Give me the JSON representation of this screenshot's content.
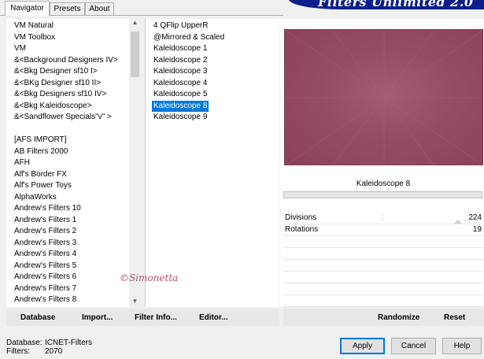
{
  "tabs": [
    {
      "label": "Navigator",
      "active": true
    },
    {
      "label": "Presets",
      "active": false
    },
    {
      "label": "About",
      "active": false
    }
  ],
  "banner": {
    "title": "Filters Unlimited 2.0",
    "color": "#0a1f8c"
  },
  "categories": [
    "VM Natural",
    "VM Toolbox",
    "VM",
    "&<Background Designers IV>",
    "&<Bkg Designer sf10 I>",
    "&<BKg Designer sf10 II>",
    "&<Bkg Designers sf10 IV>",
    "&<Bkg Kaleidoscope>",
    "&<Sandflower Specials\"v\" >",
    "",
    "[AFS IMPORT]",
    "AB Filters 2000",
    "AFH",
    "Alf's Border FX",
    "Alf's Power Toys",
    "AlphaWorks",
    "Andrew's Filters 10",
    "Andrew's Filters 1",
    "Andrew's Filters 2",
    "Andrew's Filters 3",
    "Andrew's Filters 4",
    "Andrew's Filters 5",
    "Andrew's Filters 6",
    "Andrew's Filters 7",
    "Andrew's Filters 8"
  ],
  "filters": [
    "4 QFlip UpperR",
    "@Mirrored & Scaled",
    "Kaleidoscope 1",
    "Kaleidoscope 2",
    "Kaleidoscope 3",
    "Kaleidoscope 4",
    "Kaleidoscope 5",
    "Kaleidoscope 8",
    "Kaleidoscope 9"
  ],
  "selected_filter": "Kaleidoscope 8",
  "preview": {
    "filter_name": "Kaleidoscope 8",
    "color": "#9a5268"
  },
  "params": [
    {
      "label": "Divisions",
      "value": "224"
    },
    {
      "label": "Rotations",
      "value": "19"
    }
  ],
  "toolbar": {
    "database": "Database",
    "import": "Import...",
    "filter_info": "Filter Info...",
    "editor": "Editor...",
    "randomize": "Randomize",
    "reset": "Reset"
  },
  "footer": {
    "database_label": "Database:",
    "database_value": "ICNET-Filters",
    "filters_label": "Filters:",
    "filters_value": "2070",
    "apply": "Apply",
    "cancel": "Cancel",
    "help": "Help"
  },
  "watermark": "©Simonetta",
  "selection_color": "#0078d7"
}
